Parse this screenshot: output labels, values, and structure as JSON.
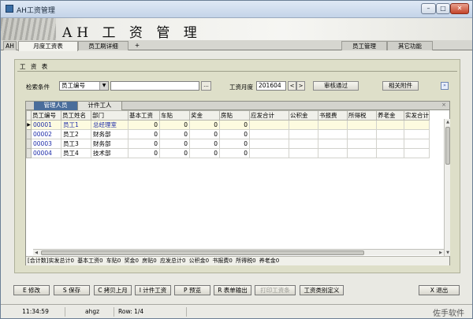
{
  "window": {
    "title": "AH工资管理",
    "min_glyph": "–",
    "max_glyph": "□",
    "close_glyph": "✕"
  },
  "banner": {
    "title": "AH 工 资 管 理"
  },
  "tabs": {
    "ah": "AH",
    "monthly": "月度工资表",
    "detail": "员工刷详细",
    "add": "+",
    "employee_mgmt": "员工管理",
    "other": "其它功能"
  },
  "panel": {
    "title": "工 资 表",
    "search_label": "检索条件",
    "search_field": "员工编号",
    "search_value": "",
    "ellipsis": "...",
    "month_label": "工资月度",
    "month_value": "201604",
    "prev": "<",
    "next": ">",
    "audit_btn": "审核通过",
    "attach_btn": "相关附件",
    "collapse_glyph": "»"
  },
  "grid": {
    "tabs": [
      "管理人员",
      "计件工人"
    ],
    "close_glyph": "×",
    "columns": [
      "员工编号",
      "员工姓名",
      "部门",
      "基本工资",
      "车贴",
      "奖金",
      "房贴",
      "应发合计",
      "公积金",
      "书报费",
      "所得税",
      "养老金",
      "实发合计"
    ],
    "rows": [
      {
        "id": "00001",
        "name": "员工1",
        "dept": "总经理室",
        "base": "0",
        "car": "0",
        "bonus": "0",
        "house": "0"
      },
      {
        "id": "00002",
        "name": "员工2",
        "dept": "财务部",
        "base": "0",
        "car": "0",
        "bonus": "0",
        "house": "0"
      },
      {
        "id": "00003",
        "name": "员工3",
        "dept": "财务部",
        "base": "0",
        "car": "0",
        "bonus": "0",
        "house": "0"
      },
      {
        "id": "00004",
        "name": "员工4",
        "dept": "技术部",
        "base": "0",
        "car": "0",
        "bonus": "0",
        "house": "0"
      }
    ],
    "selected_marker": "▶",
    "summary": [
      "[合计数]实发总计0",
      "基本工资0",
      "车贴0",
      "奖金0",
      "房贴0",
      "应发总计0",
      "公积金0",
      "书报费0",
      "所得税0",
      "养老金0"
    ]
  },
  "buttons": {
    "edit": "E 修改",
    "save": "S 保存",
    "copy_last": "C 拷贝上月",
    "piece": "I 计件工资",
    "preview": "P 预览",
    "export": "R 表单输出",
    "print": "打印工资条",
    "define": "工资类别定义",
    "exit": "X 退出"
  },
  "status": {
    "time": "11:34:59",
    "user": "ahgz",
    "row": "Row: 1/4"
  },
  "watermark": "佐手软件"
}
